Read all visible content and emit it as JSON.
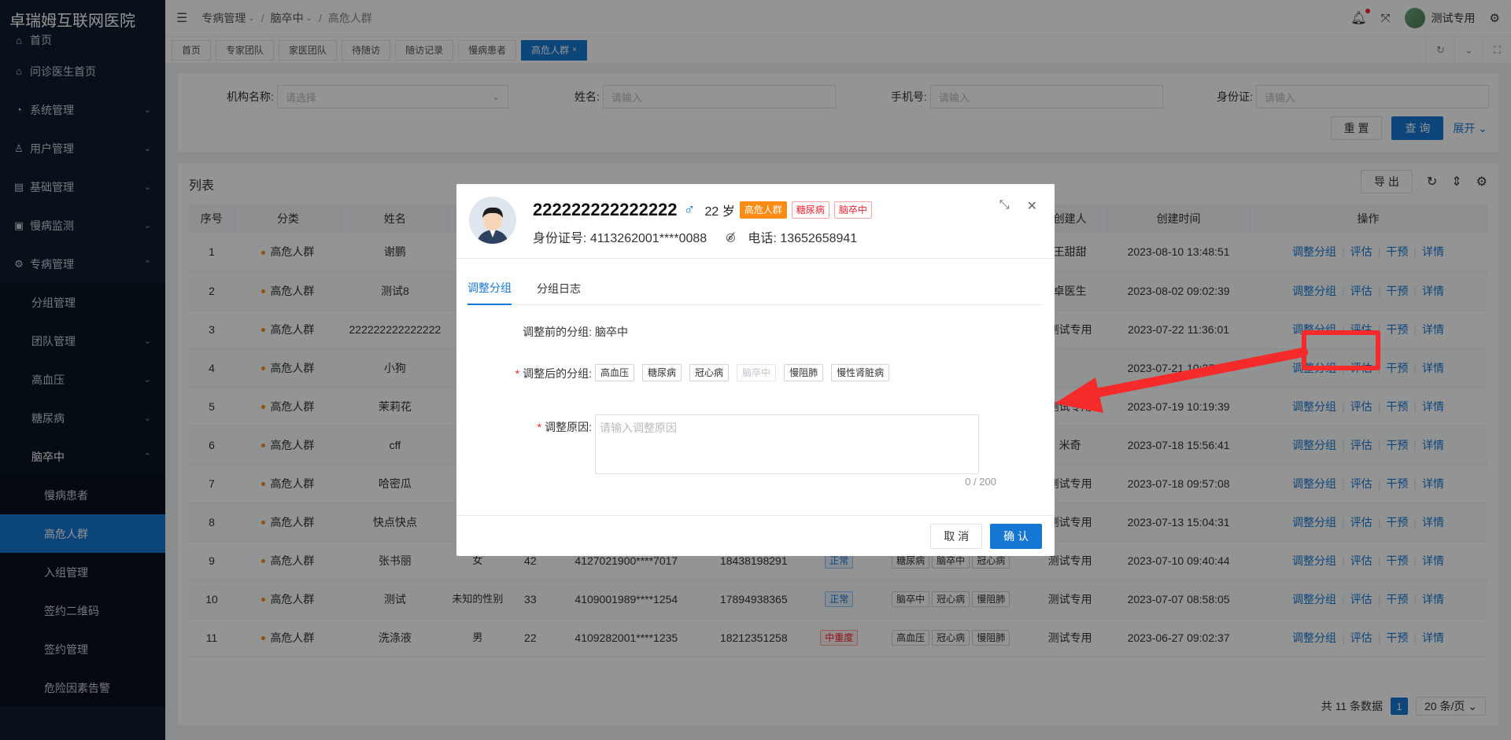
{
  "app": {
    "hospital_name": "卓瑞姆互联网医院"
  },
  "sidebar": {
    "items": [
      {
        "label": "首页",
        "icon": "home-icon"
      },
      {
        "label": "问诊医生首页",
        "icon": "home-icon"
      },
      {
        "label": "系统管理",
        "icon": "gauge-icon"
      },
      {
        "label": "用户管理",
        "icon": "user-icon"
      },
      {
        "label": "基础管理",
        "icon": "grid-icon"
      },
      {
        "label": "慢病监测",
        "icon": "monitor-icon"
      },
      {
        "label": "专病管理",
        "icon": "gear-icon"
      },
      {
        "label": "分组管理"
      },
      {
        "label": "团队管理"
      },
      {
        "label": "高血压"
      },
      {
        "label": "糖尿病"
      },
      {
        "label": "脑卒中"
      },
      {
        "label": "慢病患者"
      },
      {
        "label": "高危人群"
      },
      {
        "label": "入组管理"
      },
      {
        "label": "签约二维码"
      },
      {
        "label": "签约管理"
      },
      {
        "label": "危险因素告警"
      }
    ]
  },
  "header": {
    "breadcrumb": [
      "专病管理",
      "脑卒中",
      "高危人群"
    ],
    "username": "测试专用"
  },
  "tabs": [
    "首页",
    "专家团队",
    "家医团队",
    "待随访",
    "随访记录",
    "慢病患者",
    "高危人群"
  ],
  "search": {
    "fields": [
      {
        "label": "机构名称:",
        "placeholder": "请选择"
      },
      {
        "label": "姓名:",
        "placeholder": "请输入"
      },
      {
        "label": "手机号:",
        "placeholder": "请输入"
      },
      {
        "label": "身份证:",
        "placeholder": "请输入"
      }
    ],
    "reset": "重 置",
    "query": "查 询",
    "expand": "展开"
  },
  "list": {
    "title": "列表",
    "export": "导 出",
    "columns": [
      "序号",
      "分类",
      "姓名",
      "",
      "",
      "",
      "",
      "",
      "",
      "创建人",
      "创建时间",
      "操作"
    ],
    "ops": [
      "调整分组",
      "评估",
      "干预",
      "详情"
    ],
    "rows": [
      {
        "no": "1",
        "cat": "高危人群",
        "name": "谢鹏",
        "gender": "",
        "age": "",
        "id": "",
        "phone": "",
        "status": "",
        "tags": [],
        "creator": "王甜甜",
        "time": "2023-08-10 13:48:51"
      },
      {
        "no": "2",
        "cat": "高危人群",
        "name": "测试8",
        "gender": "",
        "age": "",
        "id": "",
        "phone": "",
        "status": "",
        "tags": [],
        "creator": "卓医生",
        "time": "2023-08-02 09:02:39"
      },
      {
        "no": "3",
        "cat": "高危人群",
        "name": "222222222222222",
        "gender": "",
        "age": "",
        "id": "",
        "phone": "",
        "status": "",
        "tags": [],
        "creator": "测试专用",
        "time": "2023-07-22 11:36:01"
      },
      {
        "no": "4",
        "cat": "高危人群",
        "name": "小狗",
        "gender": "",
        "age": "",
        "id": "",
        "phone": "",
        "status": "",
        "tags": [],
        "creator": "",
        "time": "2023-07-21 10:37:13"
      },
      {
        "no": "5",
        "cat": "高危人群",
        "name": "茉莉花",
        "gender": "",
        "age": "",
        "id": "",
        "phone": "",
        "status": "",
        "tags": [],
        "creator": "测试专用",
        "time": "2023-07-19 10:19:39"
      },
      {
        "no": "6",
        "cat": "高危人群",
        "name": "cff",
        "gender": "",
        "age": "",
        "id": "",
        "phone": "",
        "status": "",
        "tags": [],
        "creator": "米奇",
        "time": "2023-07-18 15:56:41"
      },
      {
        "no": "7",
        "cat": "高危人群",
        "name": "哈密瓜",
        "gender": "",
        "age": "",
        "id": "",
        "phone": "",
        "status": "",
        "tags": [],
        "creator": "测试专用",
        "time": "2023-07-18 09:57:08"
      },
      {
        "no": "8",
        "cat": "高危人群",
        "name": "快点快点",
        "gender": "",
        "age": "",
        "id": "",
        "phone": "",
        "status": "",
        "tags": [],
        "creator": "测试专用",
        "time": "2023-07-13 15:04:31"
      },
      {
        "no": "9",
        "cat": "高危人群",
        "name": "张书丽",
        "gender": "女",
        "age": "42",
        "id": "4127021900****7017",
        "phone": "18438198291",
        "status": "正常",
        "tags": [
          "糖尿病",
          "脑卒中",
          "冠心病"
        ],
        "creator": "测试专用",
        "time": "2023-07-10 09:40:44"
      },
      {
        "no": "10",
        "cat": "高危人群",
        "name": "测试",
        "gender": "未知的性别",
        "age": "33",
        "id": "4109001989****1254",
        "phone": "17894938365",
        "status": "正常",
        "tags": [
          "脑卒中",
          "冠心病",
          "慢阻肺"
        ],
        "creator": "测试专用",
        "time": "2023-07-07 08:58:05"
      },
      {
        "no": "11",
        "cat": "高危人群",
        "name": "洗涤液",
        "gender": "男",
        "age": "22",
        "id": "4109282001****1235",
        "phone": "18212351258",
        "status": "中重度",
        "tags": [
          "高血压",
          "冠心病",
          "慢阻肺"
        ],
        "creator": "测试专用",
        "time": "2023-06-27 09:02:37"
      }
    ],
    "pager": {
      "total": "共 11 条数据",
      "page": "1",
      "size": "20 条/页"
    }
  },
  "modal": {
    "name": "222222222222222",
    "gender_symbol": "♂",
    "age": "22 岁",
    "tags": [
      "高危人群",
      "糖尿病",
      "脑卒中"
    ],
    "id_label": "身份证号: 4113262001****0088",
    "phone_label": "电话: 13652658941",
    "tabs": [
      "调整分组",
      "分组日志"
    ],
    "before_label": "调整前的分组:",
    "before_value": "脑卒中",
    "after_label": "调整后的分组:",
    "groups": [
      "高血压",
      "糖尿病",
      "冠心病",
      "脑卒中",
      "慢阻肺",
      "慢性肾脏病"
    ],
    "reason_label": "调整原因:",
    "reason_placeholder": "请输入调整原因",
    "counter": "0 / 200",
    "cancel": "取 消",
    "confirm": "确 认"
  },
  "colors": {
    "primary": "#1677d2",
    "sidebar": "#0f1c2d",
    "annotation": "#f52a2a",
    "tag_orange": "#fa8c16"
  }
}
